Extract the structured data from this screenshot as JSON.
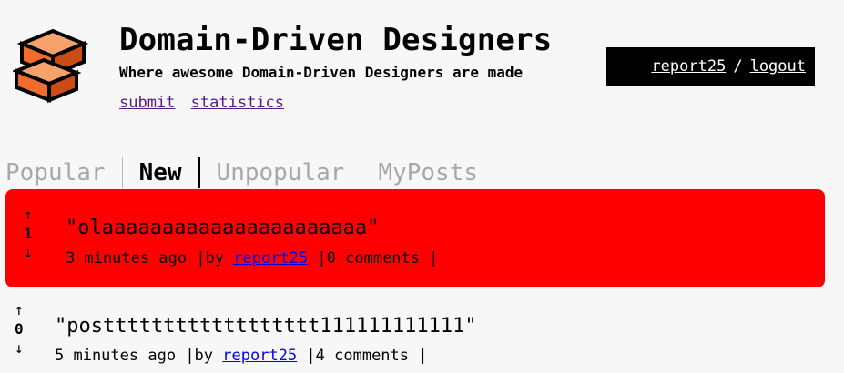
{
  "header": {
    "title": "Domain-Driven Designers",
    "tagline": "Where awesome Domain-Driven Designers are made",
    "links": {
      "submit": "submit",
      "statistics": "statistics"
    }
  },
  "user_box": {
    "username": "report25",
    "separator": "/",
    "logout": "logout"
  },
  "tabs": [
    {
      "label": "Popular",
      "active": false
    },
    {
      "label": "New",
      "active": true
    },
    {
      "label": "Unpopular",
      "active": false
    },
    {
      "label": "MyPosts",
      "active": false
    }
  ],
  "posts": [
    {
      "title": "\"olaaaaaaaaaaaaaaaaaaaaaa\"",
      "votes": "1",
      "time": "3 minutes ago",
      "by_label": "|by",
      "author": "report25",
      "comments": "|0 comments |",
      "highlighted": true
    },
    {
      "title": "\"postttttttttttttttttt111111111111\"",
      "votes": "0",
      "time": "5 minutes ago",
      "by_label": "|by",
      "author": "report25",
      "comments": "|4 comments |",
      "highlighted": false
    }
  ],
  "icons": {
    "upvote": "↑",
    "downvote": "↓"
  },
  "colors": {
    "highlight": "#ff0000",
    "background": "#f7f7f7",
    "logo_orange": "#f26d2b",
    "tab_inactive": "#a8a8a8"
  }
}
